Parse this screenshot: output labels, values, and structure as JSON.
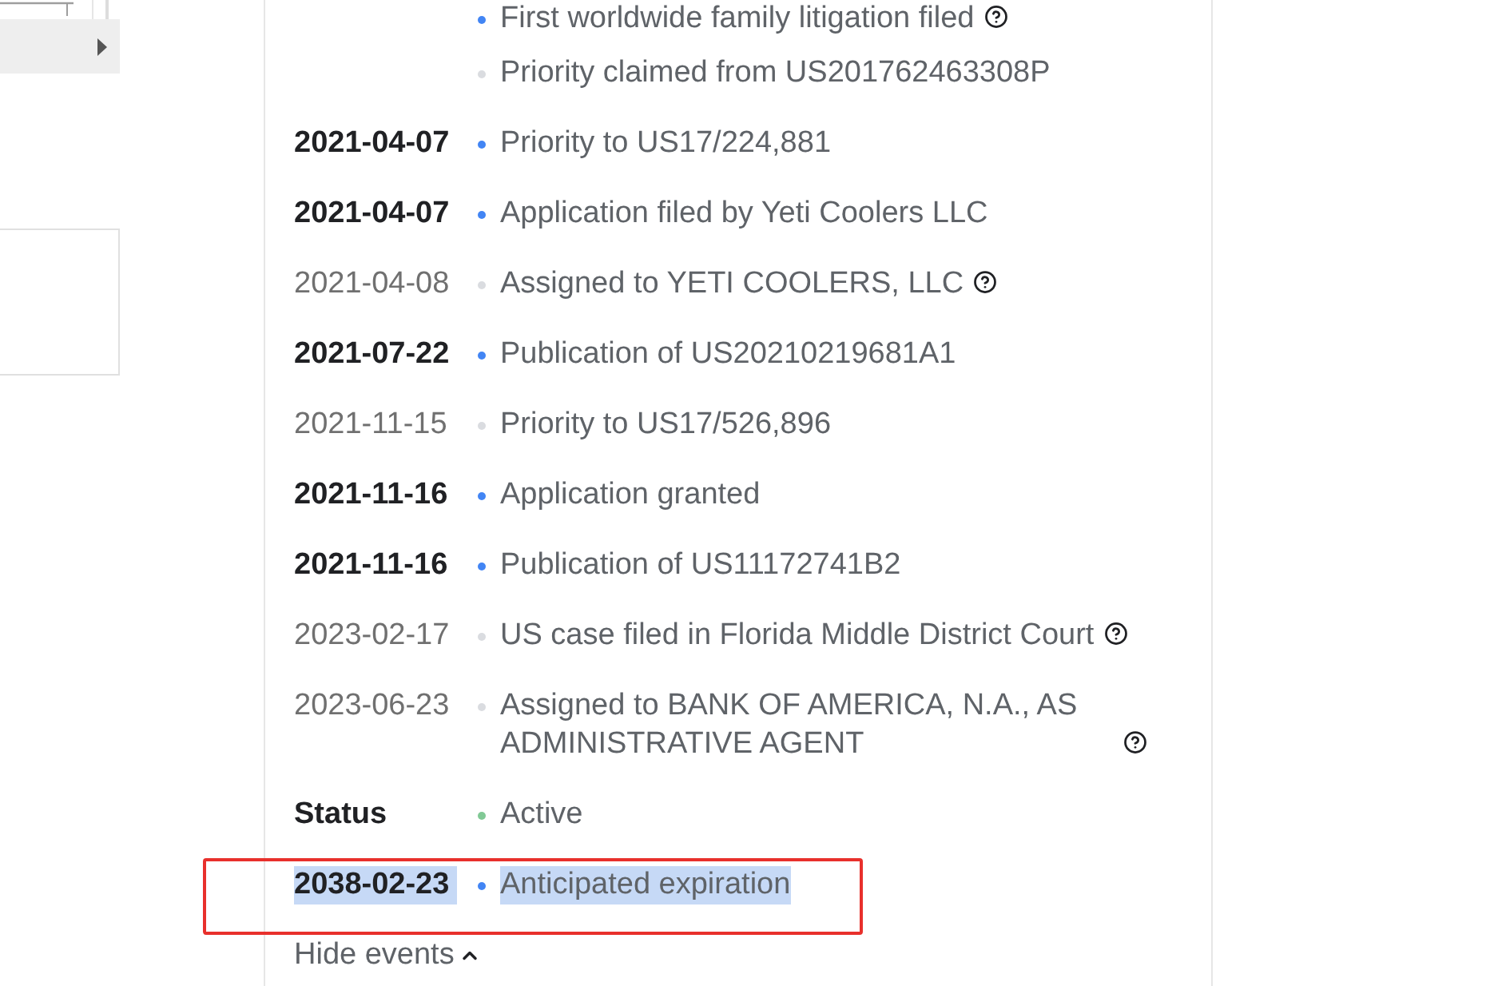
{
  "events": [
    {
      "title": "First worldwide family litigation filed",
      "color": "#4285f4",
      "help_icon": true,
      "highlighted": false
    },
    {
      "title": "Priority claimed from US201762463308P",
      "color": "#dadce0",
      "help_icon": false,
      "highlighted": false
    },
    {
      "date": "2021-04-07",
      "emphasized": true,
      "title": "Priority to US17/224,881",
      "color": "#4285f4",
      "help_icon": false,
      "highlighted": false
    },
    {
      "date": "2021-04-07",
      "emphasized": true,
      "title": "Application filed by Yeti Coolers LLC",
      "color": "#4285f4",
      "help_icon": false,
      "highlighted": false
    },
    {
      "date": "2021-04-08",
      "emphasized": false,
      "title": "Assigned to YETI COOLERS, LLC",
      "color": "#dadce0",
      "help_icon": true,
      "highlighted": false
    },
    {
      "date": "2021-07-22",
      "emphasized": true,
      "title": "Publication of US20210219681A1",
      "color": "#4285f4",
      "help_icon": false,
      "highlighted": false
    },
    {
      "date": "2021-11-15",
      "emphasized": false,
      "title": "Priority to US17/526,896",
      "color": "#dadce0",
      "help_icon": false,
      "highlighted": false
    },
    {
      "date": "2021-11-16",
      "emphasized": true,
      "title": "Application granted",
      "color": "#4285f4",
      "help_icon": false,
      "highlighted": false
    },
    {
      "date": "2021-11-16",
      "emphasized": true,
      "title": "Publication of US11172741B2",
      "color": "#4285f4",
      "help_icon": false,
      "highlighted": false
    },
    {
      "date": "2023-02-17",
      "emphasized": false,
      "title": "US case filed in Florida Middle District Court",
      "color": "#dadce0",
      "help_icon": true,
      "highlighted": false
    },
    {
      "date": "2023-06-23",
      "emphasized": false,
      "title": "Assigned to BANK OF AMERICA, N.A., AS ADMINISTRATIVE AGENT",
      "color": "#dadce0",
      "help_icon": true,
      "highlighted": false
    },
    {
      "heading": "Status",
      "emphasized": true,
      "title": "Active",
      "color": "#81c995",
      "help_icon": false,
      "highlighted": false
    },
    {
      "date": "2038-02-23",
      "emphasized": true,
      "title": "Anticipated expiration",
      "color": "#4285f4",
      "help_icon": false,
      "highlighted": true
    }
  ],
  "toggle": {
    "label": "Hide events",
    "expanded": true
  }
}
